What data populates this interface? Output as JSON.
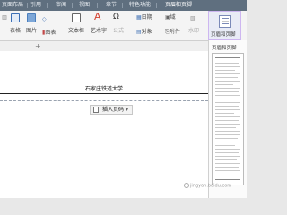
{
  "menubar": {
    "items": [
      "页面布局",
      "引用",
      "审阅",
      "视图",
      "章节",
      "特色功能",
      "页眉和页脚"
    ],
    "active_index": 6
  },
  "ribbon": {
    "row1": {
      "bullet_label": "·",
      "table_label": "表格",
      "picture_label": "图片",
      "shape_label": "形状",
      "chart_label": "图表",
      "textbox_label": "文本框",
      "art_label": "艺术字",
      "symbol_label": "符号",
      "formula_label": "公式",
      "date_label": "日期",
      "object_label": "对象",
      "field_label": "域",
      "attach_label": "附件",
      "header_footer_label": "页眉和页脚"
    },
    "row2": {
      "watermark_label": "水印"
    }
  },
  "tabstrip": {
    "add_label": "+"
  },
  "document": {
    "header_text": "石家庄铁道大学",
    "insert_page_button": "插入页码"
  },
  "panel": {
    "title": "页眉和页脚"
  },
  "watermark_text": "jingyan.baidu.com",
  "colors": {
    "menubar_bg": "#5f6f7f",
    "highlight_border": "#cdb6f0"
  }
}
